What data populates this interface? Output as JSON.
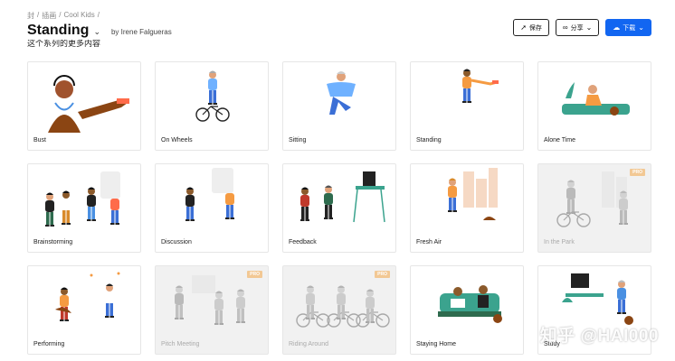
{
  "breadcrumb": [
    "封",
    "/",
    "插画",
    "/",
    "Cool Kids",
    "/"
  ],
  "header": {
    "title": "Standing",
    "author": "by Irene Falgueras",
    "subtitle": "这个系列的更多内容"
  },
  "actions": {
    "save": "保存",
    "share": "分享",
    "download": "下载"
  },
  "pro_badge": "PRO",
  "cards": [
    {
      "label": "Bust",
      "pro": false,
      "scene": "bust"
    },
    {
      "label": "On Wheels",
      "pro": false,
      "scene": "wheels"
    },
    {
      "label": "Sitting",
      "pro": false,
      "scene": "sitting"
    },
    {
      "label": "Standing",
      "pro": false,
      "scene": "standing"
    },
    {
      "label": "Alone Time",
      "pro": false,
      "scene": "alone"
    },
    {
      "label": "Brainstorming",
      "pro": false,
      "scene": "group4"
    },
    {
      "label": "Discussion",
      "pro": false,
      "scene": "pair"
    },
    {
      "label": "Feedback",
      "pro": false,
      "scene": "feedback"
    },
    {
      "label": "Fresh Air",
      "pro": false,
      "scene": "fresh"
    },
    {
      "label": "In the Park",
      "pro": true,
      "scene": "park"
    },
    {
      "label": "Performing",
      "pro": false,
      "scene": "perform"
    },
    {
      "label": "Pitch Meeting",
      "pro": true,
      "scene": "pitch"
    },
    {
      "label": "Riding Around",
      "pro": true,
      "scene": "riding"
    },
    {
      "label": "Staying Home",
      "pro": false,
      "scene": "home"
    },
    {
      "label": "Study",
      "pro": false,
      "scene": "study"
    }
  ],
  "watermark": "知乎 @HAI000"
}
